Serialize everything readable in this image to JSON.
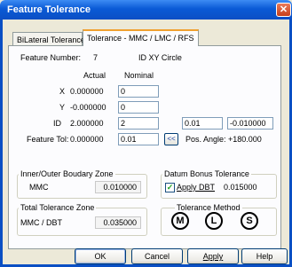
{
  "window": {
    "title": "Feature Tolerance",
    "close_glyph": "✕"
  },
  "tabs": [
    {
      "label": "BiLateral Tolerance"
    },
    {
      "label": "Tolerance - MMC / LMC / RFS"
    }
  ],
  "feature": {
    "label": "Feature Number:",
    "number": "7",
    "name": "ID XY Circle"
  },
  "columns": {
    "actual": "Actual",
    "nominal": "Nominal"
  },
  "rows": [
    {
      "label": "X",
      "actual": "0.000000",
      "nominal": "0"
    },
    {
      "label": "Y",
      "actual": "-0.000000",
      "nominal": "0"
    },
    {
      "label": "ID",
      "actual": "2.000000",
      "nominal": "2",
      "upper_tol": "0.01",
      "lower_tol": "-0.010000"
    }
  ],
  "feature_tol": {
    "label": "Feature Tol:",
    "actual": "0.000000",
    "value": "0.01",
    "arrow": "<<",
    "pos_angle_label": "Pos. Angle:",
    "pos_angle": "+180.000"
  },
  "inner_outer_zone": {
    "title": "Inner/Outer Boudary Zone",
    "label": "MMC",
    "value": "0.010000"
  },
  "datum_bonus": {
    "title": "Datum Bonus Tolerance",
    "checkbox_label": "Apply DBT",
    "checked": "✓",
    "value": "0.015000"
  },
  "total_zone": {
    "title": "Total Tolerance Zone",
    "label": "MMC / DBT",
    "value": "0.035000"
  },
  "tolerance_method": {
    "title": "Tolerance Method",
    "options": [
      "M",
      "L",
      "S"
    ]
  },
  "buttons": {
    "ok": "OK",
    "cancel": "Cancel",
    "apply": "Apply",
    "help": "Help"
  }
}
